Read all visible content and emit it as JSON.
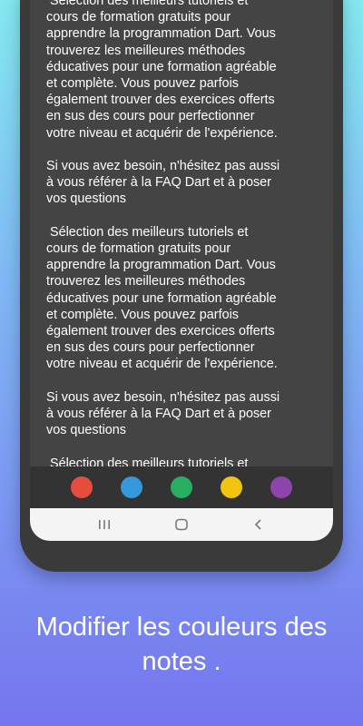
{
  "note": {
    "text": " Sélection des meilleurs tutoriels et\ncours de formation gratuits pour\napprendre la programmation Dart. Vous\ntrouverez les meilleures méthodes\néducatives pour une formation agréable\net complète. Vous pouvez parfois\négalement trouver des exercices offerts\nen sus des cours pour perfectionner\nvotre niveau et acquérir de l'expérience.\n\nSi vous avez besoin, n'hésitez pas aussi\nà vous référer à la FAQ Dart et à poser\nvos questions\n\n Sélection des meilleurs tutoriels et\ncours de formation gratuits pour\napprendre la programmation Dart. Vous\ntrouverez les meilleures méthodes\néducatives pour une formation agréable\net complète. Vous pouvez parfois\négalement trouver des exercices offerts\nen sus des cours pour perfectionner\nvotre niveau et acquérir de l'expérience.\n\nSi vous avez besoin, n'hésitez pas aussi\nà vous référer à la FAQ Dart et à poser\nvos questions\n\n Sélection des meilleurs tutoriels et"
  },
  "palette": {
    "colors": [
      "#e74c3c",
      "#3498db",
      "#27ae60",
      "#f1c40f",
      "#8e44ad"
    ]
  },
  "navbar": {
    "recents_icon": "recent-apps-icon",
    "home_icon": "home-icon",
    "back_icon": "back-icon"
  },
  "caption": {
    "line1": "Modifier les couleurs des",
    "line2": "notes ."
  }
}
